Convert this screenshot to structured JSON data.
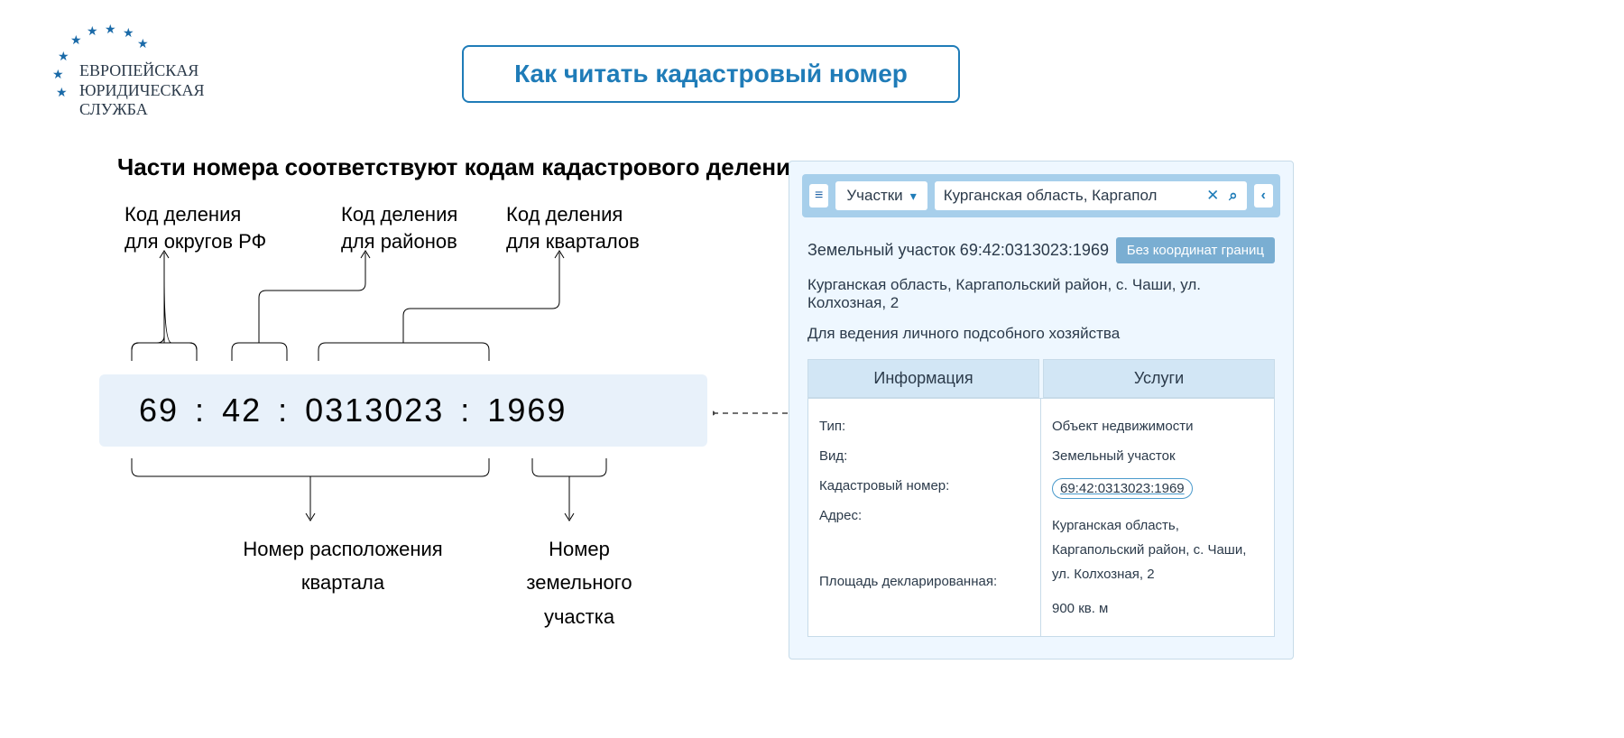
{
  "logo": {
    "line1": "ЕВРОПЕЙСКАЯ",
    "line2": "ЮРИДИЧЕСКАЯ",
    "line3": "СЛУЖБА"
  },
  "title": "Как читать кадастровый номер",
  "heading": "Части номера соответствуют кодам кадастрового деления",
  "labels": {
    "top1a": "Код деления",
    "top1b": "для округов РФ",
    "top2a": "Код деления",
    "top2b": "для районов",
    "top3a": "Код деления",
    "top3b": "для кварталов",
    "bottom1a": "Номер расположения",
    "bottom1b": "квартала",
    "bottom2a": "Номер",
    "bottom2b": "земельного",
    "bottom2c": "участка"
  },
  "cadnum": {
    "seg1": "69",
    "seg2": "42",
    "seg3": "0313023",
    "seg4": "1969",
    "sep": ":"
  },
  "panel": {
    "dropdown": "Участки",
    "search": "Курганская область, Каргапол",
    "parcel_label": "Земельный участок 69:42:0313023:1969",
    "status": "Без координат границ",
    "address": "Курганская область, Каргапольский район, с. Чаши, ул. Колхозная, 2",
    "purpose": "Для ведения личного подсобного хозяйства",
    "tab1": "Информация",
    "tab2": "Услуги",
    "rows_left": {
      "r1": "Тип:",
      "r2": "Вид:",
      "r3": "Кадастровый номер:",
      "r4": "Адрес:",
      "r5": "Площадь декларированная:"
    },
    "rows_right": {
      "r1": "Объект недвижимости",
      "r2": "Земельный участок",
      "r3": "69:42:0313023:1969",
      "r4": "Курганская область, Каргапольский район, с. Чаши, ул. Колхозная, 2",
      "r5": "900 кв. м"
    }
  }
}
